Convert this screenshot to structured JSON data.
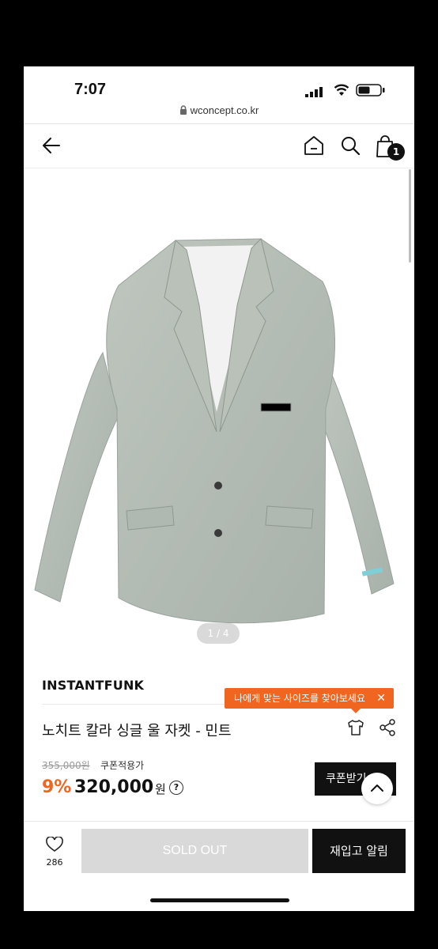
{
  "status_bar": {
    "time": "7:07"
  },
  "browser": {
    "url": "wconcept.co.kr"
  },
  "nav": {
    "cart_count": "1"
  },
  "gallery": {
    "pager": "1 / 4"
  },
  "product": {
    "brand": "INSTANTFUNK",
    "name": "노치트 칼라 싱글 울 자켓 - 민트",
    "size_tooltip": "나에게 맞는 사이즈를 찾아보세요",
    "original_price": "355,000원",
    "coupon_note": "쿠폰적용가",
    "discount": "9%",
    "price": "320,000",
    "currency": "원",
    "help": "?",
    "coupon_button": "쿠폰받기"
  },
  "bottom_bar": {
    "like_count": "286",
    "sold_out": "SOLD OUT",
    "restock": "재입고 알림"
  },
  "colors": {
    "accent": "#f0651f",
    "jacket": "#b4bdb5"
  }
}
